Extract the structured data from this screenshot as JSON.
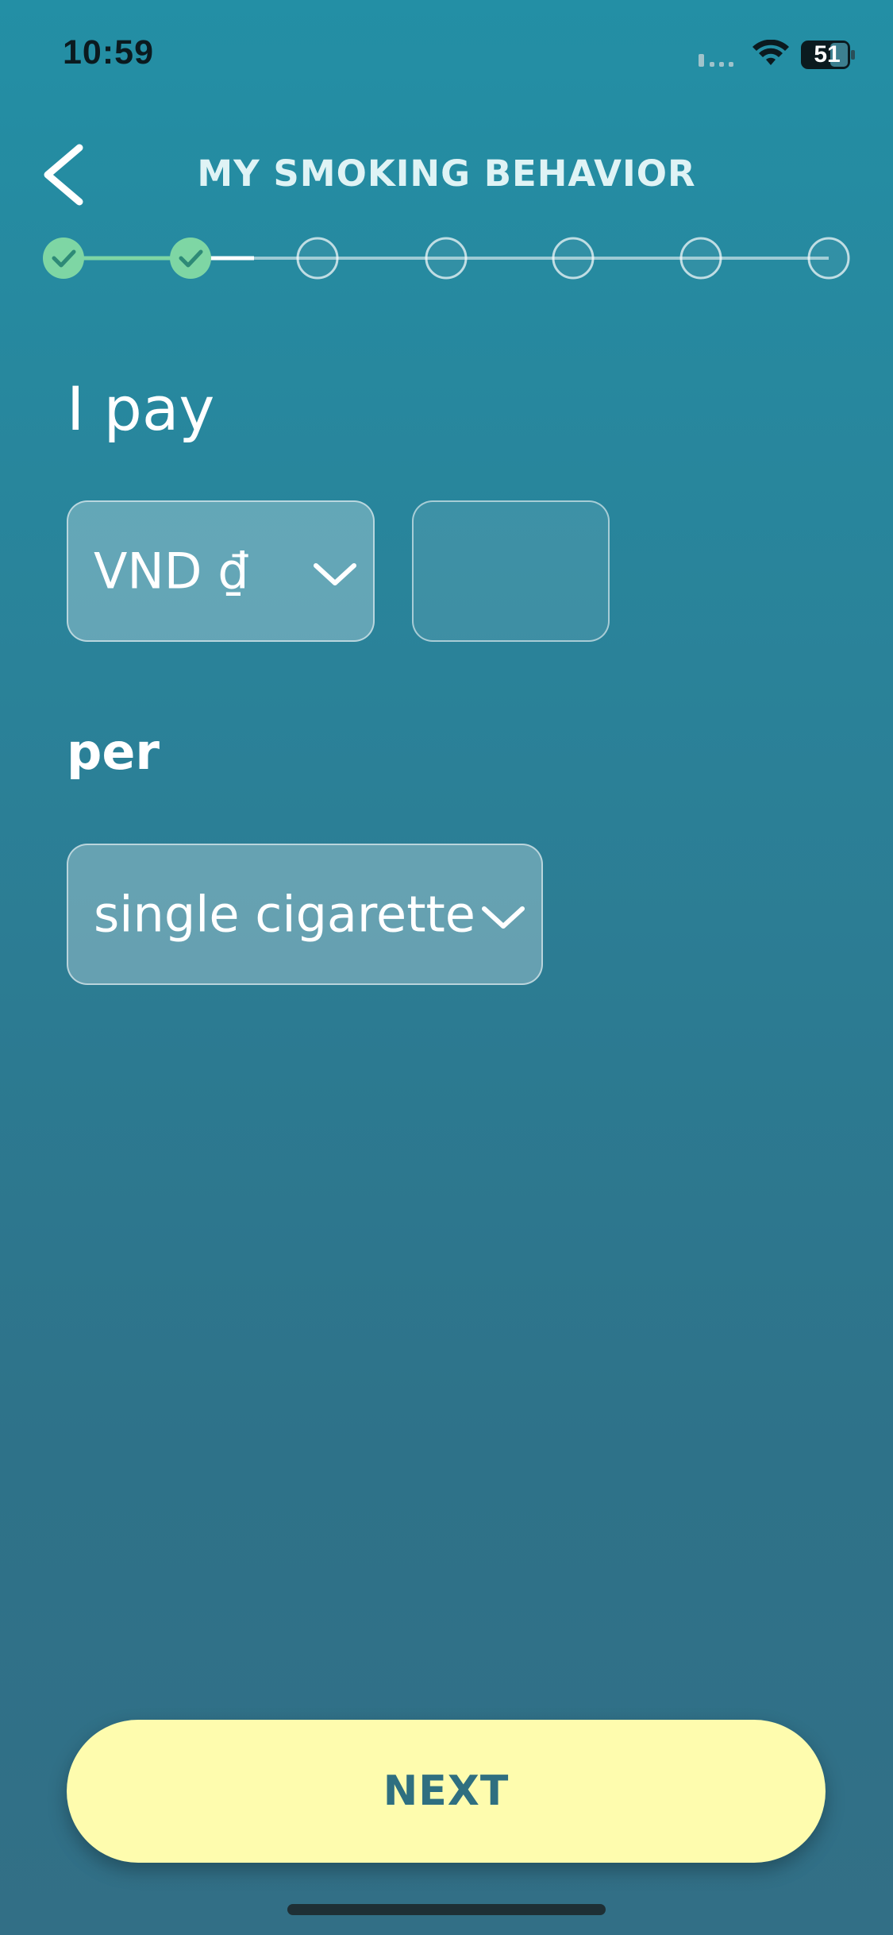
{
  "status_bar": {
    "time": "10:59",
    "battery_level": "51",
    "signal_icon": "cellular-signal-icon",
    "wifi_icon": "wifi-icon",
    "battery_icon": "battery-icon"
  },
  "header": {
    "title": "MY SMOKING BEHAVIOR",
    "back_icon": "chevron-left-icon"
  },
  "stepper": {
    "total_steps": 7,
    "completed_steps": 2,
    "current_progress_fraction": 0.5,
    "completed_color": "#7ed6a4",
    "check_color": "#2e8a77"
  },
  "form": {
    "question": "I pay",
    "currency": {
      "selected": "VND ₫",
      "icon": "chevron-down-icon"
    },
    "amount": {
      "value": "",
      "placeholder": ""
    },
    "per_label": "per",
    "unit": {
      "selected": "single cigarette",
      "icon": "chevron-down-icon"
    }
  },
  "actions": {
    "next_label": "NEXT"
  },
  "colors": {
    "background_top": "#238fa5",
    "background_bottom": "#326f86",
    "next_button_bg": "#fefcae",
    "next_button_text": "#2f6f80"
  }
}
